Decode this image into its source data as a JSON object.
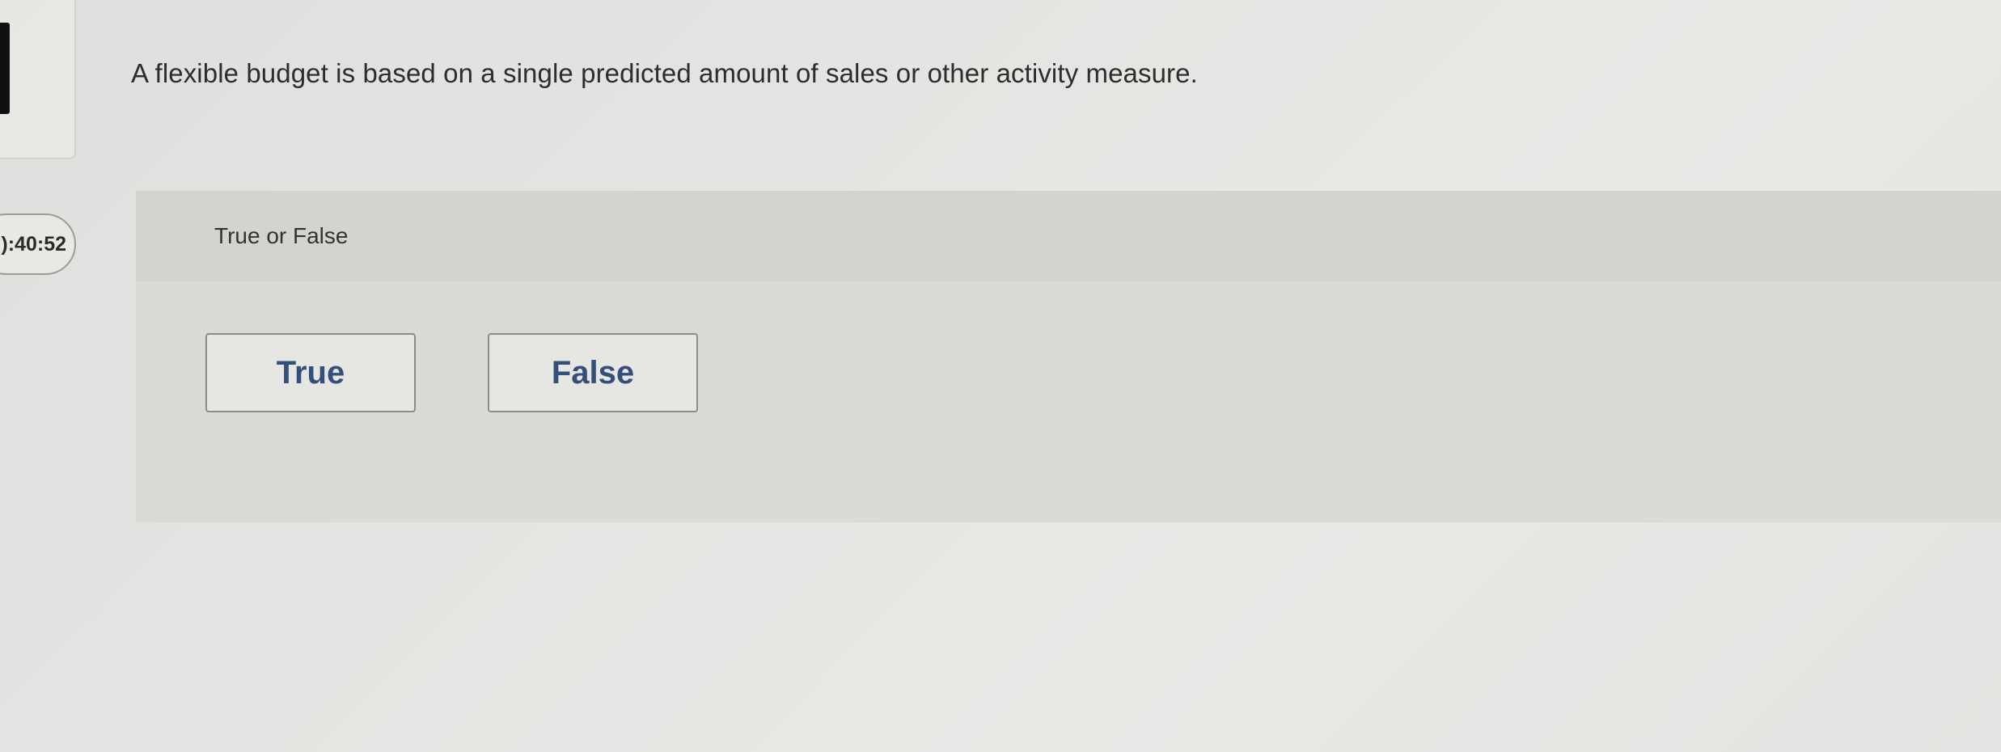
{
  "timer": {
    "display": "):40:52"
  },
  "question": {
    "text": "A flexible budget is based on a single predicted amount of sales or other activity measure."
  },
  "answer_panel": {
    "prompt_label": "True or False",
    "choices": [
      {
        "label": "True"
      },
      {
        "label": "False"
      }
    ]
  },
  "colors": {
    "choice_text": "#34507a",
    "question_text": "#2d2d2d",
    "panel_background": "#dadad7"
  }
}
